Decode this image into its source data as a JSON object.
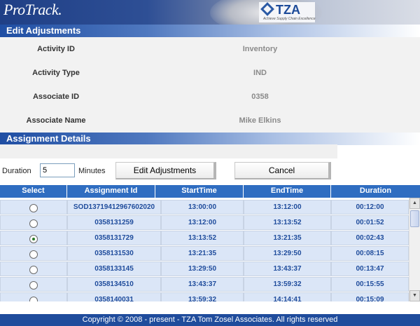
{
  "header": {
    "logo_text": "ProTrack.",
    "partner_logo_text": "TZA",
    "partner_tagline": "Achieve Supply Chain Excellence"
  },
  "edit_adjustments": {
    "title": "Edit Adjustments",
    "fields": [
      {
        "label": "Activity ID",
        "value": "Inventory"
      },
      {
        "label": "Activity Type",
        "value": "IND"
      },
      {
        "label": "Associate ID",
        "value": "0358"
      },
      {
        "label": "Associate Name",
        "value": "Mike Elkins"
      }
    ]
  },
  "assignment_details": {
    "title": "Assignment Details",
    "duration_label": "Duration",
    "duration_value": "5",
    "minutes_label": "Minutes",
    "edit_button": "Edit Adjustments",
    "cancel_button": "Cancel"
  },
  "table": {
    "columns": [
      "Select",
      "Assignment Id",
      "StartTime",
      "EndTime",
      "Duration"
    ],
    "rows": [
      {
        "selected": false,
        "assignment_id": "SOD13719412967602020",
        "start": "13:00:00",
        "end": "13:12:00",
        "duration": "00:12:00"
      },
      {
        "selected": false,
        "assignment_id": "0358131259",
        "start": "13:12:00",
        "end": "13:13:52",
        "duration": "00:01:52"
      },
      {
        "selected": true,
        "assignment_id": "0358131729",
        "start": "13:13:52",
        "end": "13:21:35",
        "duration": "00:02:43"
      },
      {
        "selected": false,
        "assignment_id": "0358131530",
        "start": "13:21:35",
        "end": "13:29:50",
        "duration": "00:08:15"
      },
      {
        "selected": false,
        "assignment_id": "0358133145",
        "start": "13:29:50",
        "end": "13:43:37",
        "duration": "00:13:47"
      },
      {
        "selected": false,
        "assignment_id": "0358134510",
        "start": "13:43:37",
        "end": "13:59:32",
        "duration": "00:15:55"
      },
      {
        "selected": false,
        "assignment_id": "0358140031",
        "start": "13:59:32",
        "end": "14:14:41",
        "duration": "00:15:09"
      }
    ]
  },
  "footer": {
    "text": "Copyright © 2008 - present - TZA Tom Zosel Associates. All rights reserved"
  },
  "colors": {
    "header_blue": "#1f4ea3",
    "table_header": "#2f6dc1",
    "row_fill": "#dbe6f7",
    "cell_text": "#1f4c9c",
    "footer": "#1f4c9c"
  }
}
